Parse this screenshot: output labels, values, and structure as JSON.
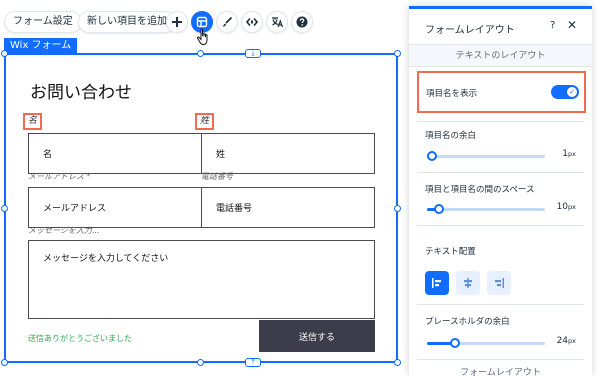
{
  "toolbar": {
    "form_settings": "フォーム設定",
    "add_item": "新しい項目を追加",
    "icons": [
      "plus-icon",
      "layout-icon",
      "brush-icon",
      "code-icon",
      "translate-icon",
      "help-icon"
    ]
  },
  "canvas": {
    "tag": "Wix フォーム",
    "title": "お問い合わせ",
    "labels": {
      "first_name": "名",
      "last_name": "姓",
      "email": "メールアドレス *",
      "phone": "電話番号",
      "message": "メッセージを入力..."
    },
    "placeholders": {
      "first_name": "名",
      "last_name": "姓",
      "email": "メールアドレス",
      "phone": "電話番号",
      "message": "メッセージを入力してください"
    },
    "success_message": "送信ありがとうございました",
    "submit_label": "送信する"
  },
  "panel": {
    "title": "フォームレイアウト",
    "help": "?",
    "close": "✕",
    "section_title": "テキストのレイアウト",
    "show_labels": {
      "label": "項目名を表示",
      "on": true
    },
    "label_margin": {
      "label": "項目名の余白",
      "value": "1",
      "unit": "px",
      "fraction": 0.03
    },
    "label_spacing": {
      "label": "項目と項目名の間のスペース",
      "value": "10",
      "unit": "px",
      "fraction": 0.1
    },
    "text_align": {
      "label": "テキスト配置",
      "options": [
        "left",
        "center",
        "right"
      ],
      "selected": "left"
    },
    "placeholder_margin": {
      "label": "プレースホルダの余白",
      "value": "24",
      "unit": "px",
      "fraction": 0.24
    },
    "footer": "フォームレイアウト"
  },
  "colors": {
    "accent": "#116dff",
    "highlight": "#f26b4e",
    "success": "#2ea94f",
    "submit_bg": "#3c3d4a"
  }
}
